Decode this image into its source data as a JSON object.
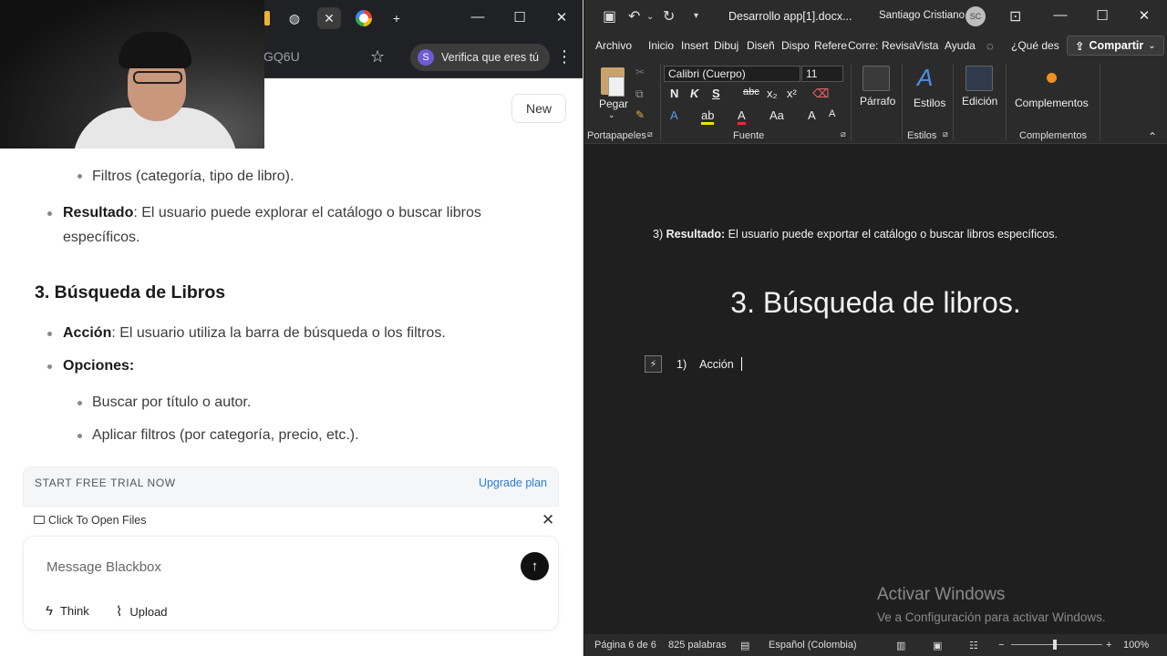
{
  "browser": {
    "address_fragment": "GQ6U",
    "verify_label": "Verifica que eres tú",
    "new_button": "New",
    "chat": {
      "item_filters": "Filtros (categoría, tipo de libro).",
      "result_label": "Resultado",
      "result_text_line1": ": El usuario puede explorar el catálogo o buscar libros",
      "result_text_line2": "específicos.",
      "heading": "3. Búsqueda de Libros",
      "action_label": "Acción",
      "action_text": ": El usuario utiliza la barra de búsqueda o los filtros.",
      "options_label": "Opciones",
      "options_colon": ":",
      "option1": "Buscar por título o autor.",
      "option2": "Aplicar filtros (por categoría, precio, etc.)."
    },
    "trial_text": "START FREE TRIAL NOW",
    "upgrade_text": "Upgrade plan",
    "files_text": "Click To Open Files",
    "message_placeholder": "Message Blackbox",
    "think_label": "Think",
    "upload_label": "Upload"
  },
  "word": {
    "doc_title": "Desarrollo app[1].docx...",
    "user_name": "Santiago Cristiano",
    "avatar_initials": "SC",
    "tabs": [
      "Archivo",
      "Inicio",
      "Insert",
      "Dibuj",
      "Diseñ",
      "Dispo",
      "Refere",
      "Corre:",
      "Revisa",
      "Vista",
      "Ayuda"
    ],
    "tell_me": "¿Qué des",
    "share_label": "Compartir",
    "ribbon": {
      "paste_label": "Pegar",
      "clipboard_group": "Portapapeles",
      "font_name": "Calibri (Cuerpo)",
      "font_size": "11",
      "font_group": "Fuente",
      "paragraph_label": "Párrafo",
      "styles_label": "Estilos",
      "styles_group": "Estilos",
      "editing_label": "Edición",
      "addins_label": "Complementos",
      "addins_group": "Complementos"
    },
    "document": {
      "line1_prefix": "3) ",
      "line1_bold": "Resultado:",
      "line1_text": " El usuario puede exportar el catálogo o buscar libros específicos.",
      "heading": "3. Búsqueda de libros.",
      "list_number": "1)",
      "list_text": "Acción"
    },
    "watermark_title": "Activar Windows",
    "watermark_sub": "Ve a Configuración para activar Windows.",
    "status": {
      "page": "Página 6 de 6",
      "words": "825 palabras",
      "language": "Español (Colombia)",
      "zoom": "100%"
    }
  }
}
